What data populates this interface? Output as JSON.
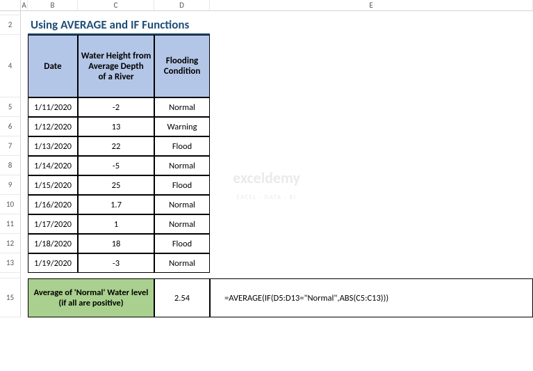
{
  "columns": [
    "A",
    "B",
    "C",
    "D",
    "E"
  ],
  "rows": [
    "2",
    "4",
    "5",
    "6",
    "7",
    "8",
    "9",
    "10",
    "11",
    "12",
    "13",
    "15"
  ],
  "title": "Using AVERAGE and IF Functions",
  "headers": {
    "date": "Date",
    "height": "Water Height from Average Depth\nof a River",
    "condition": "Flooding Condition"
  },
  "records": [
    {
      "date": "1/11/2020",
      "height": "-2",
      "condition": "Normal"
    },
    {
      "date": "1/12/2020",
      "height": "13",
      "condition": "Warning"
    },
    {
      "date": "1/13/2020",
      "height": "22",
      "condition": "Flood"
    },
    {
      "date": "1/14/2020",
      "height": "-5",
      "condition": "Normal"
    },
    {
      "date": "1/15/2020",
      "height": "25",
      "condition": "Flood"
    },
    {
      "date": "1/16/2020",
      "height": "1.7",
      "condition": "Normal"
    },
    {
      "date": "1/17/2020",
      "height": "1",
      "condition": "Normal"
    },
    {
      "date": "1/18/2020",
      "height": "18",
      "condition": "Flood"
    },
    {
      "date": "1/19/2020",
      "height": "-3",
      "condition": "Normal"
    }
  ],
  "summary": {
    "label": "Average of 'Normal' Water level\n(if all are positive)",
    "value": "2.54",
    "formula": "=AVERAGE(IF(D5:D13=\"Normal\",ABS(C5:C13)))"
  },
  "watermark": {
    "main": "exceldemy",
    "sub": "EXCEL · DATA · BI"
  }
}
